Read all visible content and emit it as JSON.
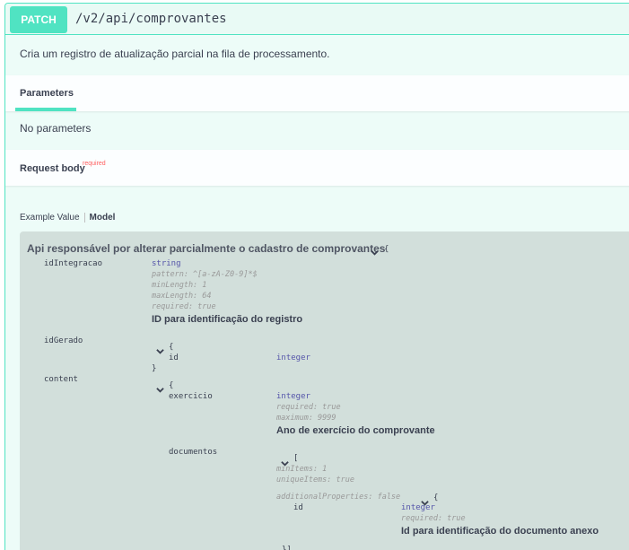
{
  "operation": {
    "method": "PATCH",
    "path": "/v2/api/comprovantes",
    "description": "Cria um registro de atualização parcial na fila de processamento."
  },
  "parameters": {
    "tab_label": "Parameters",
    "empty_text": "No parameters"
  },
  "request_body": {
    "label": "Request body",
    "required_badge": "required",
    "tabs": {
      "example": "Example Value",
      "model": "Model"
    }
  },
  "model": {
    "title": "Api responsável por alterar parcialmente o cadastro de comprovantes",
    "open_brace": "{",
    "close_brace": "}",
    "fields": {
      "idIntegracao": {
        "name": "idIntegracao",
        "type": "string",
        "pattern": "pattern: ^[a-zA-Z0-9]*$",
        "minLength": "minLength: 1",
        "maxLength": "maxLength: 64",
        "required": "required: true",
        "description": "ID para identificação do registro"
      },
      "idGerado": {
        "name": "idGerado",
        "open_brace": "{",
        "close_brace": "}",
        "id_name": "id",
        "id_type": "integer"
      },
      "content": {
        "name": "content",
        "open_brace": "{",
        "exercicio": {
          "name": "exercicio",
          "type": "integer",
          "required": "required: true",
          "maximum": "maximum: 9999",
          "description": "Ano de exercício do comprovante"
        },
        "documentos": {
          "name": "documentos",
          "open_bracket": "[",
          "minItems": "minItems: 1",
          "uniqueItems": "uniqueItems: true",
          "additionalProperties": "additionalProperties: false",
          "item_open_brace": "{",
          "id_name": "id",
          "id_type": "integer",
          "id_required": "required: true",
          "id_description": "Id para identificação do documento anexo",
          "trailing": "}]"
        }
      }
    }
  },
  "colors": {
    "accent": "#50e3c2",
    "panel_bg": "#edfcf8",
    "model_bg": "#d2dfdb",
    "required_red": "#ff6060"
  }
}
